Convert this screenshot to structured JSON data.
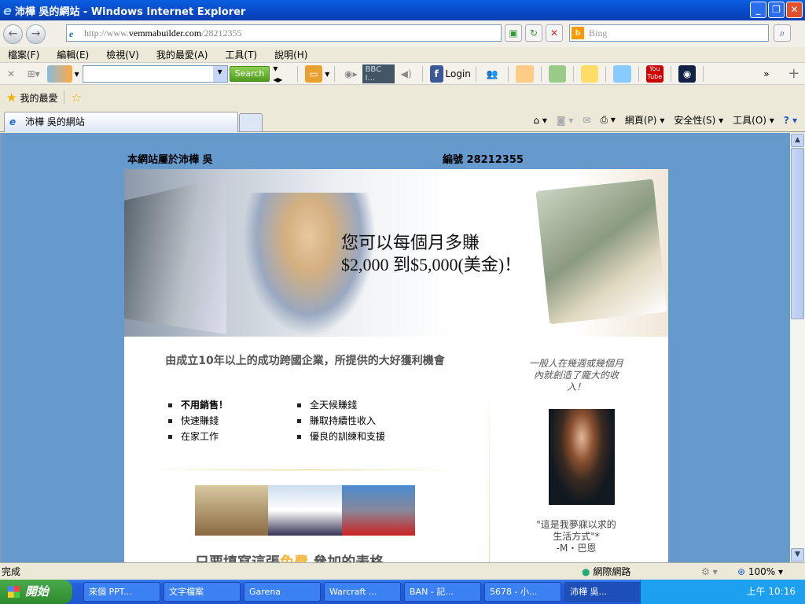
{
  "window": {
    "title": "沛樺 吳的網站 - Windows Internet Explorer",
    "min": "_",
    "max": "❐",
    "close": "✕"
  },
  "nav": {
    "back": "←",
    "forward": "→",
    "url_prefix": "http://www.",
    "url_domain": "vemmabuilder.com",
    "url_path": "/28212355",
    "search_placeholder": "Bing",
    "refresh": "↻",
    "stop": "✕"
  },
  "menu": [
    "檔案(F)",
    "編輯(E)",
    "檢視(V)",
    "我的最愛(A)",
    "工具(T)",
    "說明(H)"
  ],
  "toolbar": {
    "search_label": "Search",
    "radio": "BBC I...",
    "facebook_login": "Login",
    "youtube": "You Tube",
    "more": "»"
  },
  "favorites": {
    "label": "我的最愛"
  },
  "tab": {
    "label": "沛樺 吳的網站"
  },
  "commands": [
    "網頁(P)",
    "安全性(S)",
    "工具(O)"
  ],
  "page": {
    "owner": "本網站屬於沛樺 吳",
    "id_label": "編號",
    "id": "28212355",
    "hero_line1": "您可以每個月多賺",
    "hero_line2": "$2,000 到$5,000(美金)！",
    "lead": "由成立10年以上的成功跨國企業，所提供的大好獲利機會",
    "bullets_left": [
      "不用銷售！",
      "快速賺錢",
      "在家工作"
    ],
    "bullets_right": [
      "全天候賺錢",
      "賺取持續性收入",
      "優良的訓練和支援"
    ],
    "bottom_pre": "只要填寫這張",
    "bottom_free": "免費",
    "bottom_post": " 參加的表格",
    "side_quote": "一般人在幾週或幾個月內就創造了龐大的收入！",
    "testimonial": "\"這是我夢寐以求的生活方式\"*",
    "testimonial_author": "-M・巴恩"
  },
  "status": {
    "text": "完成",
    "zone": "網際網路",
    "zoom": "100%"
  },
  "taskbar": {
    "start": "開始",
    "tasks": [
      "來個 PPT...",
      "文字檔案",
      "Garena",
      "Warcraft ...",
      "BAN - 記...",
      "5678 - 小...",
      "沛樺 吳..."
    ],
    "clock": "上午 10:16"
  }
}
